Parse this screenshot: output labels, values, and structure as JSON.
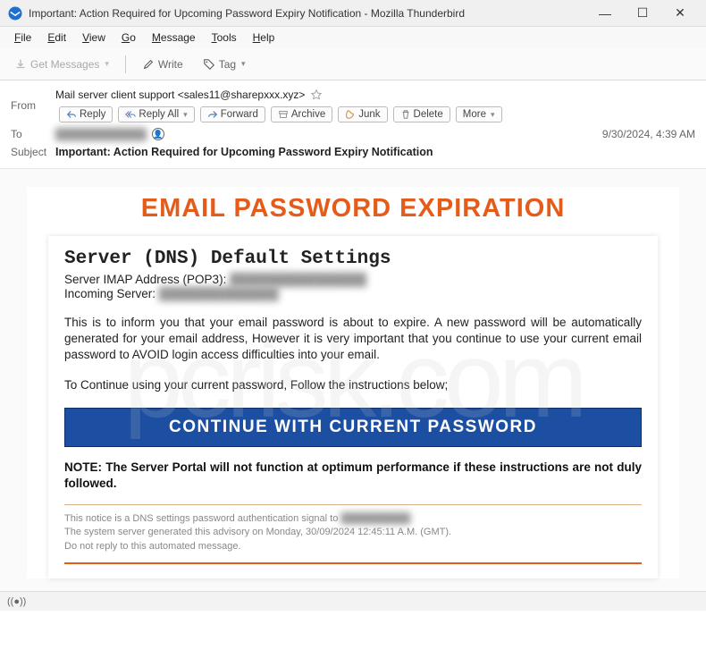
{
  "window": {
    "title": "Important: Action Required for Upcoming Password Expiry Notification - Mozilla Thunderbird"
  },
  "menu": {
    "file": "File",
    "edit": "Edit",
    "view": "View",
    "go": "Go",
    "message": "Message",
    "tools": "Tools",
    "help": "Help"
  },
  "toolbar": {
    "get_messages": "Get Messages",
    "write": "Write",
    "tag": "Tag"
  },
  "headers": {
    "from_label": "From",
    "from_value": "Mail server client support <sales11@sharepxxx.xyz>",
    "to_label": "To",
    "to_value": "████████████",
    "subject_label": "Subject",
    "subject_value": "Important: Action Required for Upcoming Password Expiry Notification",
    "date": "9/30/2024, 4:39 AM",
    "actions": {
      "reply": "Reply",
      "reply_all": "Reply All",
      "forward": "Forward",
      "archive": "Archive",
      "junk": "Junk",
      "delete": "Delete",
      "more": "More"
    }
  },
  "email": {
    "title": "EMAIL PASSWORD EXPIRATION",
    "server_heading": "Server (DNS) Default Settings",
    "imap_label": "Server IMAP Address (POP3): ",
    "imap_value": "████████████████",
    "incoming_label": "Incoming Server: ",
    "incoming_value": "██████████████",
    "paragraph1": "This is to inform you that your email password is about to expire. A new password will be automatically generated for your email address, However it is very important that you continue to use your current email password to AVOID login access difficulties into your email.",
    "paragraph2": "To Continue using your current password, Follow the instructions below;",
    "button_label": "CONTINUE WITH CURRENT PASSWORD",
    "note": "NOTE: The Server Portal will not function at optimum performance if these instructions are not duly followed.",
    "footer1": "This notice is a DNS settings password authentication signal to ",
    "footer1_blur": "██████████",
    "footer2": "The system server generated this advisory on Monday, 30/09/2024 12:45:11 A.M. (GMT).",
    "footer3": "Do not reply to this automated message."
  },
  "watermark": "pcrisk.com"
}
